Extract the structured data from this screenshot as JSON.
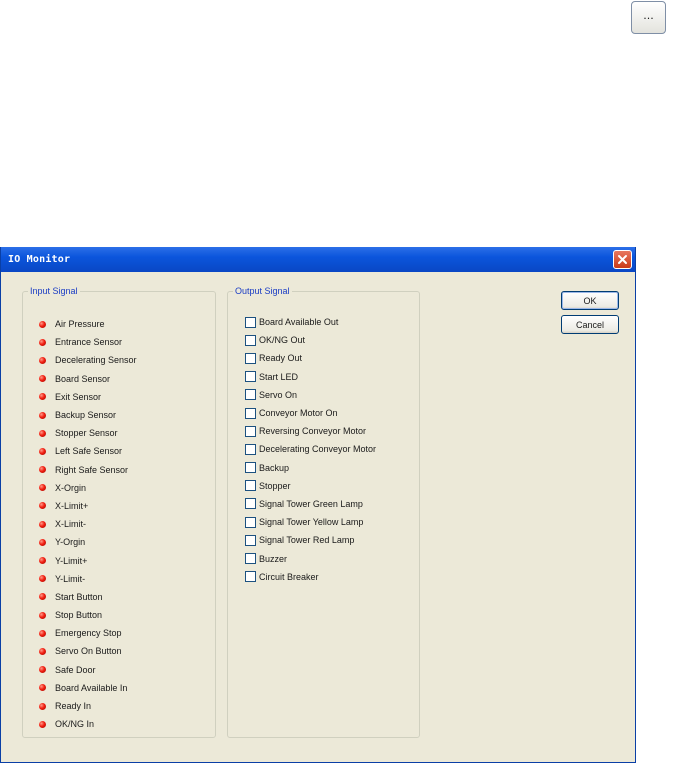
{
  "browse_button": {
    "label": "..."
  },
  "window": {
    "title": "IO Monitor"
  },
  "input_group": {
    "legend": "Input Signal",
    "items": [
      "Air Pressure",
      "Entrance Sensor",
      "Decelerating Sensor",
      "Board Sensor",
      "Exit Sensor",
      "Backup Sensor",
      "Stopper Sensor",
      "Left Safe Sensor",
      "Right Safe Sensor",
      "X-Orgin",
      "X-Limit+",
      "X-Limit-",
      "Y-Orgin",
      "Y-Limit+",
      "Y-Limit-",
      "Start Button",
      "Stop Button",
      "Emergency Stop",
      "Servo On Button",
      "Safe Door",
      "Board Available In",
      "Ready In",
      "OK/NG In"
    ]
  },
  "output_group": {
    "legend": "Output Signal",
    "items": [
      "Board Available Out",
      "OK/NG Out",
      "Ready Out",
      "Start LED",
      "Servo On",
      "Conveyor Motor On",
      "Reversing Conveyor Motor",
      "Decelerating Conveyor Motor",
      "Backup",
      "Stopper",
      "Signal Tower Green Lamp",
      "Signal Tower Yellow Lamp",
      "Signal Tower Red Lamp",
      "Buzzer",
      "Circuit Breaker"
    ]
  },
  "buttons": {
    "ok": "OK",
    "cancel": "Cancel"
  },
  "colors": {
    "titlebar": "#0b55dc",
    "dialog_bg": "#ece9d8",
    "legend_text": "#1a3cc4",
    "led_red": "#f21e10"
  },
  "icons": {
    "close": "close-icon",
    "input_indicator": "red-led-icon"
  }
}
